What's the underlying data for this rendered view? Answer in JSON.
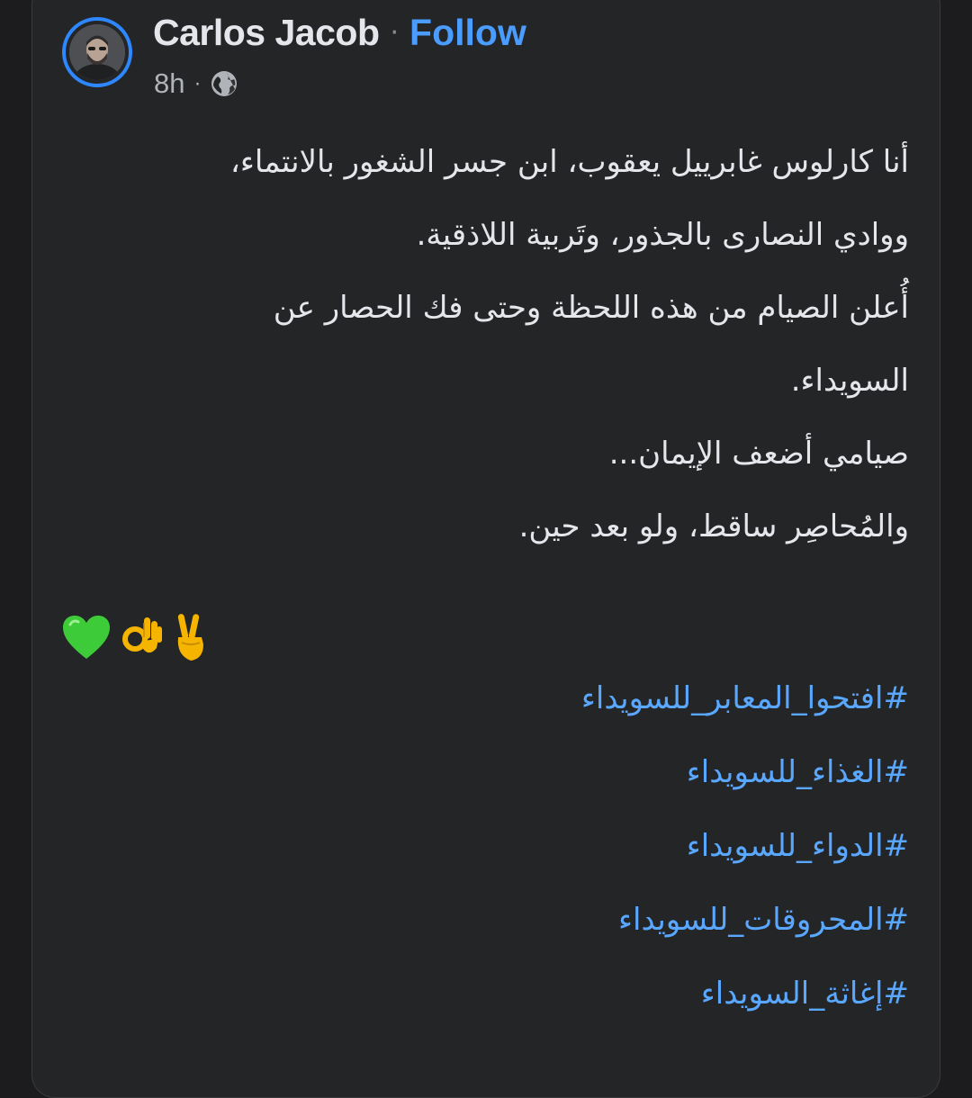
{
  "post": {
    "author": {
      "name": "Carlos Jacob",
      "avatar_icon": "profile-photo"
    },
    "separator": "·",
    "follow_label": "Follow",
    "time": "8h",
    "meta_separator": "·",
    "audience_icon": "globe-icon",
    "body_lines": [
      "أنا كارلوس غابرييل يعقوب، ابن جسر الشغور بالانتماء،",
      "ووادي النصارى بالجذور، وتَربية اللاذقية.",
      "أُعلن الصيام من هذه اللحظة وحتى فك الحصار عن",
      "السويداء.",
      "صيامي أضعف الإيمان...",
      "والمُحاصِر ساقط، ولو بعد حين."
    ],
    "emojis": [
      "✌️",
      "👌",
      "💚"
    ],
    "hashtags": [
      "#افتحوا_المعابر_للسويداء",
      "#الغذاء_للسويداء",
      "#الدواء_للسويداء",
      "#المحروقات_للسويداء",
      "#إغاثة_السويداء"
    ]
  },
  "colors": {
    "background": "#242526",
    "text": "#e4e6eb",
    "link": "#4a9dff",
    "hashtag": "#5aa7ff",
    "secondary": "#b0b3b8",
    "avatar_ring": "#2d88ff"
  }
}
